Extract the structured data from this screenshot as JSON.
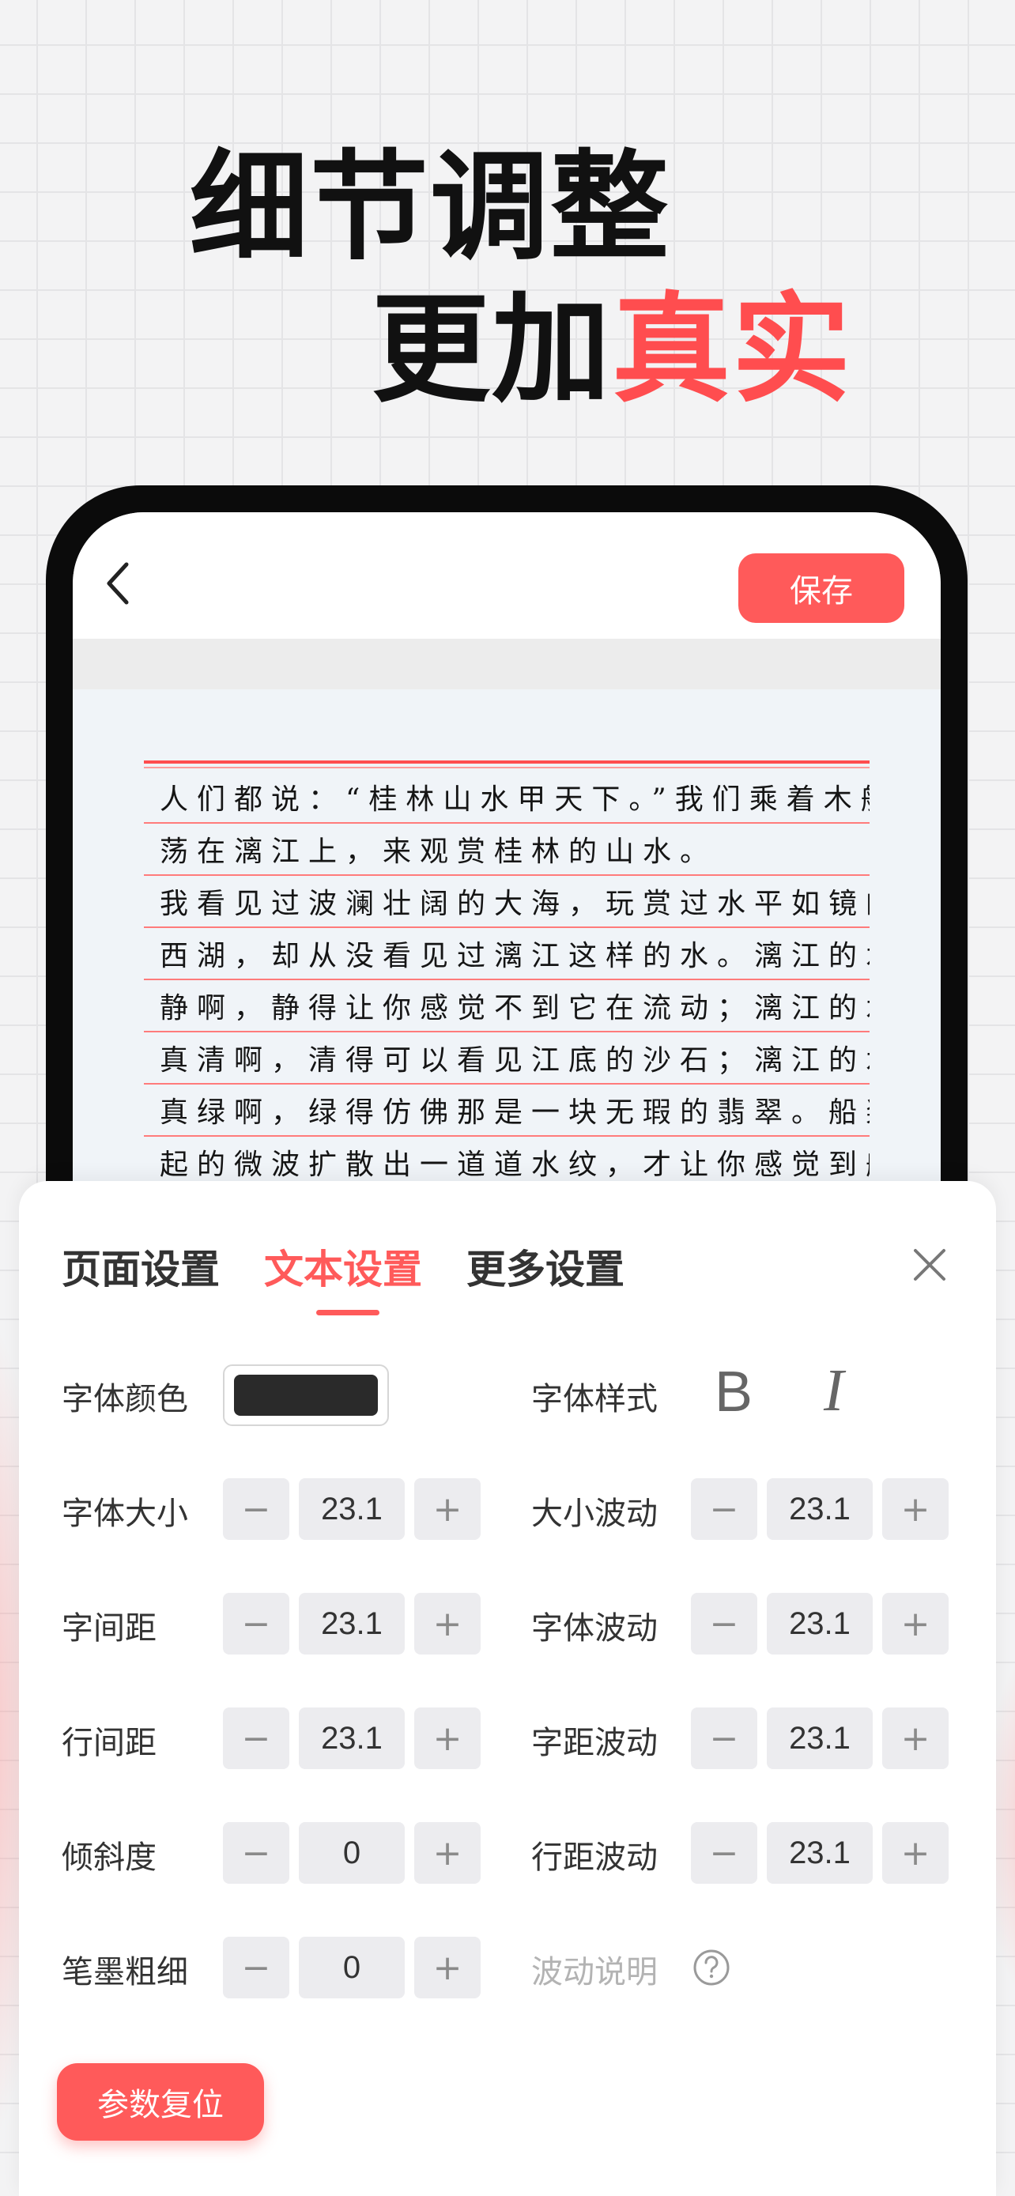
{
  "headline": {
    "line1": "细节调整",
    "line2_plain": "更加",
    "line2_accent": "真实"
  },
  "editor": {
    "save_label": "保存",
    "handwriting_lines": [
      "人们都说：“桂林山水甲天下。”我们乘着木船",
      "荡在漓江上，来观赏桂林的山水。",
      "我看见过波澜壮阔的大海，玩赏过水平如镜的",
      "西湖，却从没看见过漓江这样的水。漓江的水真",
      "静啊，静得让你感觉不到它在流动；漓江的水",
      "真清啊，清得可以看见江底的沙石；漓江的水",
      "真绿啊，绿得仿佛那是一块无瑕的翡翠。船桨激",
      "起的微波扩散出一道道水纹，才让你感觉到船"
    ]
  },
  "sheet": {
    "tabs": [
      "页面设置",
      "文本设置",
      "更多设置"
    ],
    "active_tab": "文本设置",
    "font_color_label": "字体颜色",
    "font_color_value": "#2a2a2a",
    "font_style_label": "字体样式",
    "bold_glyph": "B",
    "italic_glyph": "I",
    "minus": "−",
    "plus": "+",
    "left_rows": [
      {
        "label": "字体大小",
        "value": "23.1"
      },
      {
        "label": "字间距",
        "value": "23.1"
      },
      {
        "label": "行间距",
        "value": "23.1"
      },
      {
        "label": "倾斜度",
        "value": "0"
      },
      {
        "label": "笔墨粗细",
        "value": "0"
      }
    ],
    "right_rows": [
      {
        "label": "大小波动",
        "value": "23.1"
      },
      {
        "label": "字体波动",
        "value": "23.1"
      },
      {
        "label": "字距波动",
        "value": "23.1"
      },
      {
        "label": "行距波动",
        "value": "23.1"
      }
    ],
    "wave_help_label": "波动说明",
    "reset_label": "参数复位"
  },
  "colors": {
    "accent": "#ff5a5a",
    "headline_accent": "#ff4d4f"
  }
}
